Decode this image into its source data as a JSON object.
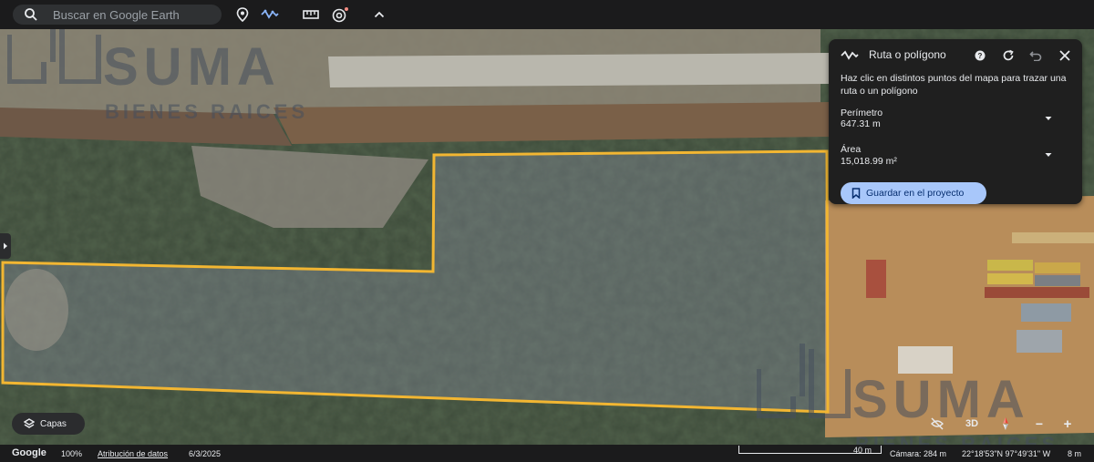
{
  "search": {
    "placeholder": "Buscar en Google Earth"
  },
  "toolbar": {
    "icons": [
      "search-icon",
      "place-pin-icon",
      "path-icon",
      "ruler-icon",
      "history-icon",
      "collapse-up-icon"
    ]
  },
  "watermark": {
    "brand": "SUMA",
    "tagline": "BIENES RAICES"
  },
  "measure_panel": {
    "title": "Ruta o polígono",
    "description": "Haz clic en distintos puntos del mapa para trazar una ruta o un polígono",
    "perimeter_label": "Perímetro",
    "perimeter_value": "647.31 m",
    "area_label": "Área",
    "area_value": "15,018.99 m²",
    "save_button": "Guardar en el proyecto"
  },
  "layers_button": {
    "label": "Capas"
  },
  "map_controls": {
    "three_d": "3D",
    "zoom_out": "−",
    "zoom_in": "+"
  },
  "status_bar": {
    "logo": "Google",
    "zoom": "100%",
    "attribution": "Atribución de datos",
    "date": "6/3/2025",
    "scale": "40 m",
    "camera": "Cámara: 284 m",
    "coordinates": "22°18'53\"N 97°49'31\" W",
    "elevation": "8 m"
  },
  "colors": {
    "polygon_outline": "#f2b632",
    "accent_button": "#a8c7fa",
    "panel_bg": "#1f1f1f",
    "toolbar_bg": "#1b1b1c"
  }
}
